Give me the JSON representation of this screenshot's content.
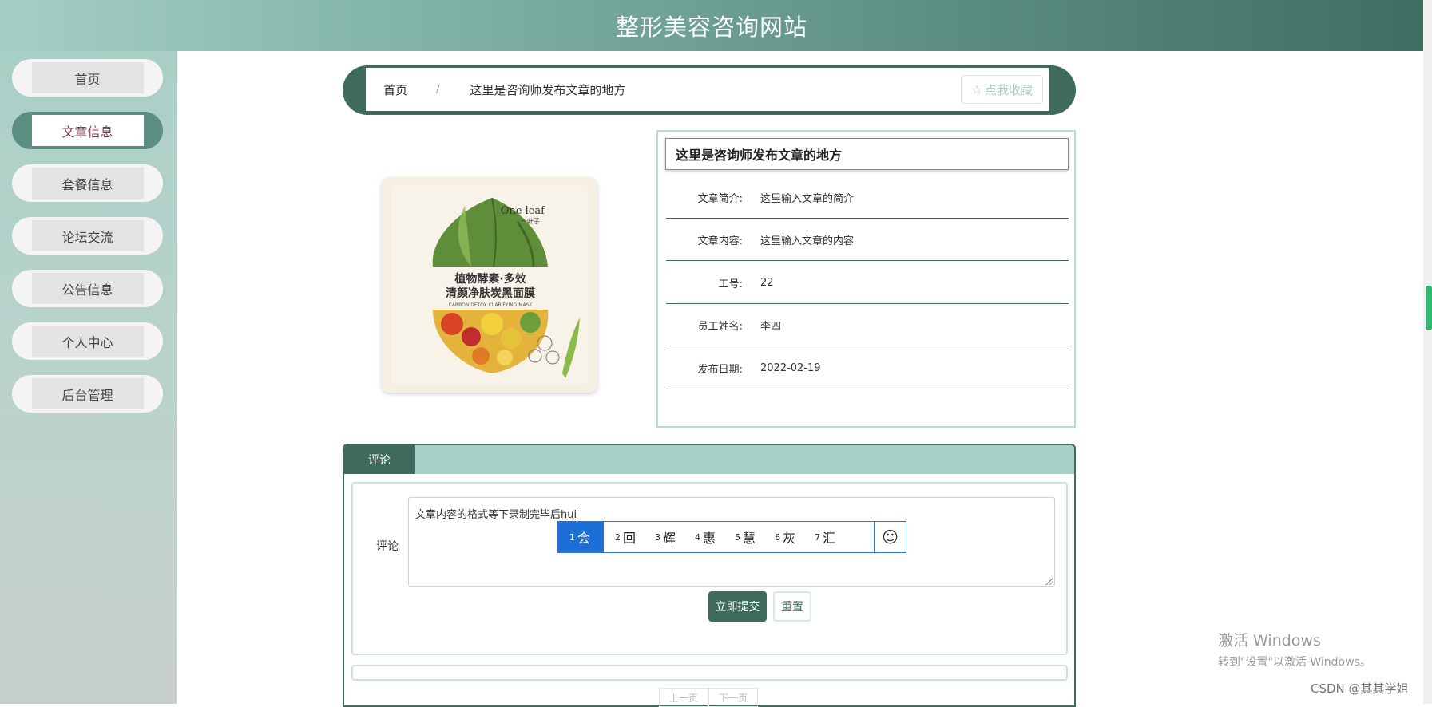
{
  "header": {
    "title": "整形美容咨询网站"
  },
  "sidebar": {
    "items": [
      {
        "label": "首页"
      },
      {
        "label": "文章信息",
        "active": true
      },
      {
        "label": "套餐信息"
      },
      {
        "label": "论坛交流"
      },
      {
        "label": "公告信息"
      },
      {
        "label": "个人中心"
      },
      {
        "label": "后台管理"
      }
    ]
  },
  "breadcrumb": {
    "home": "首页",
    "separator": "/",
    "current": "这里是咨询师发布文章的地方",
    "favorite_label": "点我收藏",
    "favorite_icon": "star-outline-icon"
  },
  "product_image": {
    "brand": "One leaf",
    "brand_cn": "一叶子",
    "line1": "植物酵素·多效",
    "line2": "清颜净肤炭黑面膜",
    "line3": "CARBON DETOX CLARIFYING MASK"
  },
  "article": {
    "title": "这里是咨询师发布文章的地方",
    "fields": [
      {
        "label": "文章简介:",
        "value": "这里输入文章的简介"
      },
      {
        "label": "文章内容:",
        "value": "这里输入文章的内容"
      },
      {
        "label": "工号:",
        "value": "22"
      },
      {
        "label": "员工姓名:",
        "value": "李四"
      },
      {
        "label": "发布日期:",
        "value": "2022-02-19"
      }
    ]
  },
  "comments": {
    "tab_label": "评论",
    "form_label": "评论",
    "textarea_text": "文章内容的格式等下录制完毕后",
    "textarea_composing": "hui",
    "submit_label": "立即提交",
    "reset_label": "重置",
    "pager": {
      "prev": "上一页",
      "next": "下一页"
    }
  },
  "ime": {
    "candidates": [
      {
        "num": "1",
        "text": "会"
      },
      {
        "num": "2",
        "text": "回"
      },
      {
        "num": "3",
        "text": "辉"
      },
      {
        "num": "4",
        "text": "惠"
      },
      {
        "num": "5",
        "text": "慧"
      },
      {
        "num": "6",
        "text": "灰"
      },
      {
        "num": "7",
        "text": "汇"
      }
    ],
    "emoji_icon": "smiley-icon"
  },
  "watermark": {
    "line1": "激活 Windows",
    "line2": "转到\"设置\"以激活 Windows。",
    "csdn": "CSDN @其其学姐"
  },
  "colors": {
    "primary": "#3f6b5f",
    "accent_light": "#a6cfc5",
    "active_text": "#7f3b4a",
    "ime_select": "#1d6fd8"
  }
}
